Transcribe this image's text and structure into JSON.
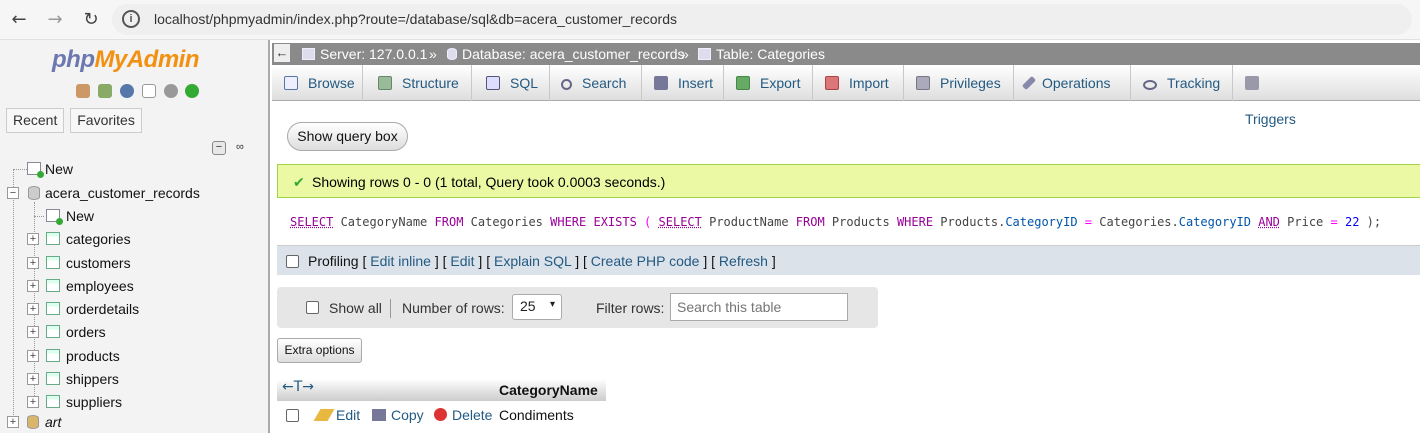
{
  "browser": {
    "url": "localhost/phpmyadmin/index.php?route=/database/sql&db=acera_customer_records",
    "back": "←",
    "forward": "→",
    "reload": "↻",
    "info": "i"
  },
  "logo": {
    "php": "php",
    "my": "MyAdmin"
  },
  "left_tabs": {
    "recent": "Recent",
    "favorites": "Favorites"
  },
  "tree": {
    "new_top": "New",
    "database": "acera_customer_records",
    "new_table": "New",
    "tables": [
      "categories",
      "customers",
      "employees",
      "orderdetails",
      "orders",
      "products",
      "shippers",
      "suppliers"
    ],
    "next_db": "art"
  },
  "breadcrumb": {
    "server": "Server: 127.0.0.1",
    "database": "Database: acera_customer_records",
    "table": "Table: Categories",
    "sep": "»"
  },
  "menu": [
    "Browse",
    "Structure",
    "SQL",
    "Search",
    "Insert",
    "Export",
    "Import",
    "Privileges",
    "Operations",
    "Tracking",
    "Triggers"
  ],
  "show_query_box": "Show query box",
  "success": "Showing rows 0 - 0 (1 total, Query took 0.0003 seconds.)",
  "sql": {
    "t1": "SELECT",
    "t2": " CategoryName ",
    "t3": "FROM",
    "t4": " Categories ",
    "t5": "WHERE EXISTS",
    "t6": " ( ",
    "t7": "SELECT",
    "t8": " ProductName ",
    "t9": "FROM",
    "t10": " Products ",
    "t11": "WHERE",
    "t12": " Products.",
    "t13": "CategoryID",
    "t14": " = ",
    "t15": "Categories.",
    "t16": "CategoryID",
    "t17": " ",
    "t18": "AND",
    "t19": " Price ",
    "t20": "=",
    "t21": " ",
    "t22": "22",
    "t23": " );"
  },
  "profiling": {
    "label": "Profiling",
    "b1": " [ ",
    "edit_inline": "Edit inline",
    "b2": " ] [ ",
    "edit": "Edit",
    "b3": " ] [ ",
    "explain": "Explain SQL",
    "b4": " ] [ ",
    "create_php": "Create PHP code",
    "b5": " ] [ ",
    "refresh": "Refresh",
    "b6": " ]"
  },
  "navbar": {
    "show_all": "Show all",
    "number_of_rows": "Number of rows:",
    "rows_value": "25",
    "filter_rows": "Filter rows:",
    "search_placeholder": "Search this table"
  },
  "extra_options": "Extra options",
  "results": {
    "arrows": "←T→",
    "column": "CategoryName",
    "rows": [
      {
        "edit": "Edit",
        "copy": "Copy",
        "delete": "Delete",
        "value": "Condiments"
      }
    ]
  },
  "colors": {
    "link": "#235a81",
    "success_bg": "#ebf8a4",
    "breadcrumb_bg": "#8a8a8a",
    "php_logo": "#6c78af",
    "myadmin_logo": "#f29111"
  }
}
